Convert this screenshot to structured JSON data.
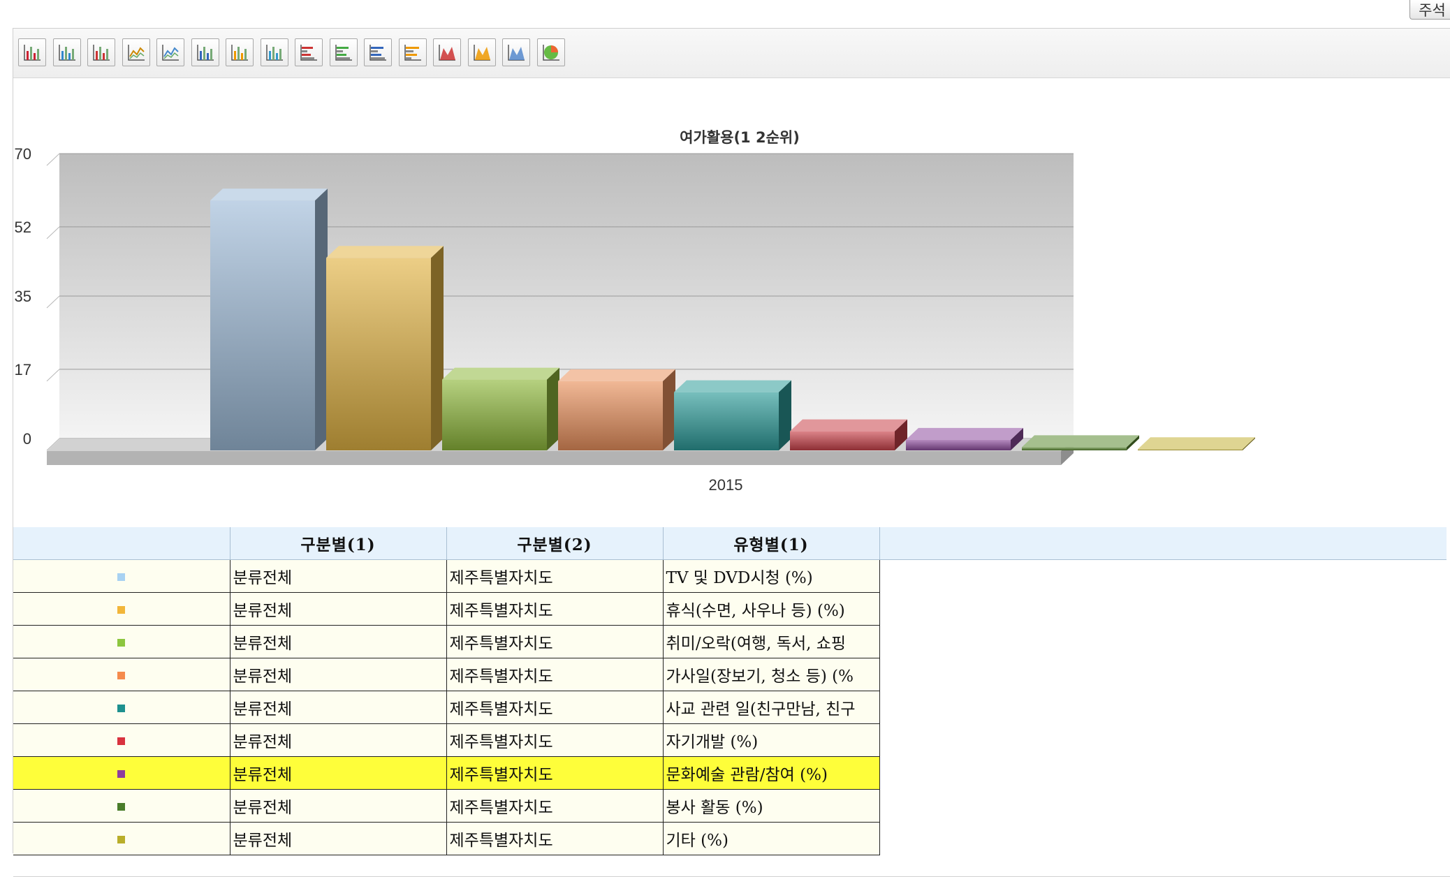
{
  "annotation_button": {
    "label": "주석"
  },
  "toolbar": {
    "buttons": [
      {
        "icon": "bar-chart-icon"
      },
      {
        "icon": "bar-chart-blue-icon"
      },
      {
        "icon": "bar-chart-red-icon"
      },
      {
        "icon": "line-chart-icon"
      },
      {
        "icon": "line-chart-alt-icon"
      },
      {
        "icon": "column-chart-blue-icon"
      },
      {
        "icon": "column-chart-orange-icon"
      },
      {
        "icon": "column-chart-multi-icon"
      },
      {
        "icon": "horizontal-bar-red-icon"
      },
      {
        "icon": "horizontal-bar-green-icon"
      },
      {
        "icon": "horizontal-bar-blue-icon"
      },
      {
        "icon": "horizontal-bar-orange-icon"
      },
      {
        "icon": "area-chart-red-icon"
      },
      {
        "icon": "area-chart-orange-icon"
      },
      {
        "icon": "area-chart-blue-icon"
      },
      {
        "icon": "pie-chart-icon"
      }
    ]
  },
  "chart_data": {
    "type": "bar",
    "title": "여가활용(1 2순위)",
    "categories": [
      "2015"
    ],
    "yticks": [
      0,
      17,
      35,
      52,
      70
    ],
    "ylim": [
      0,
      70
    ],
    "grid": true,
    "legend": "table-below",
    "series": [
      {
        "name": "TV 및 DVD시청 (%)",
        "values": [
          61.4
        ],
        "color": "#9fbcd9"
      },
      {
        "name": "휴식(수면, 사우나 등) (%)",
        "values": [
          47.3
        ],
        "color": "#e2b445"
      },
      {
        "name": "취미/오락(여행, 독서, 쇼핑",
        "values": [
          17.4
        ],
        "color": "#8fb83c"
      },
      {
        "name": "가사일(장보기, 청소 등) (%",
        "values": [
          17.0
        ],
        "color": "#ea925e"
      },
      {
        "name": "사교 관련 일(친구만남, 친구",
        "values": [
          14.3
        ],
        "color": "#2e9c9a"
      },
      {
        "name": "자기개발 (%)",
        "values": [
          4.7
        ],
        "color": "#c9424a"
      },
      {
        "name": "문화예술 관람/참여 (%)",
        "values": [
          2.6
        ],
        "color": "#8e4d9e"
      },
      {
        "name": "봉사 활동 (%)",
        "values": [
          0.8
        ],
        "color": "#5b8a32"
      },
      {
        "name": "기타 (%)",
        "values": [
          0.3
        ],
        "color": "#c4b339"
      }
    ]
  },
  "table": {
    "headers": [
      "",
      "구분별(1)",
      "구분별(2)",
      "유형별(1)",
      ""
    ],
    "rows": [
      {
        "color": "#a8d2f2",
        "col1": "분류전체",
        "col2": "제주특별자치도",
        "col3": "TV 및 DVD시청 (%)"
      },
      {
        "color": "#f2b63a",
        "col1": "분류전체",
        "col2": "제주특별자치도",
        "col3": "휴식(수면, 사우나 등) (%)"
      },
      {
        "color": "#8dc63f",
        "col1": "분류전체",
        "col2": "제주특별자치도",
        "col3": "취미/오락(여행, 독서, 쇼핑"
      },
      {
        "color": "#f58b4c",
        "col1": "분류전체",
        "col2": "제주특별자치도",
        "col3": "가사일(장보기, 청소 등) (%"
      },
      {
        "color": "#1e918e",
        "col1": "분류전체",
        "col2": "제주특별자치도",
        "col3": "사교 관련 일(친구만남, 친구"
      },
      {
        "color": "#d9333f",
        "col1": "분류전체",
        "col2": "제주특별자치도",
        "col3": "자기개발 (%)"
      },
      {
        "color": "#8e3d9e",
        "col1": "분류전체",
        "col2": "제주특별자치도",
        "col3": "문화예술 관람/참여 (%)",
        "highlight": true
      },
      {
        "color": "#4a7d2a",
        "col1": "분류전체",
        "col2": "제주특별자치도",
        "col3": "봉사 활동 (%)"
      },
      {
        "color": "#b9ae2a",
        "col1": "분류전체",
        "col2": "제주특별자치도",
        "col3": "기타 (%)"
      }
    ]
  }
}
